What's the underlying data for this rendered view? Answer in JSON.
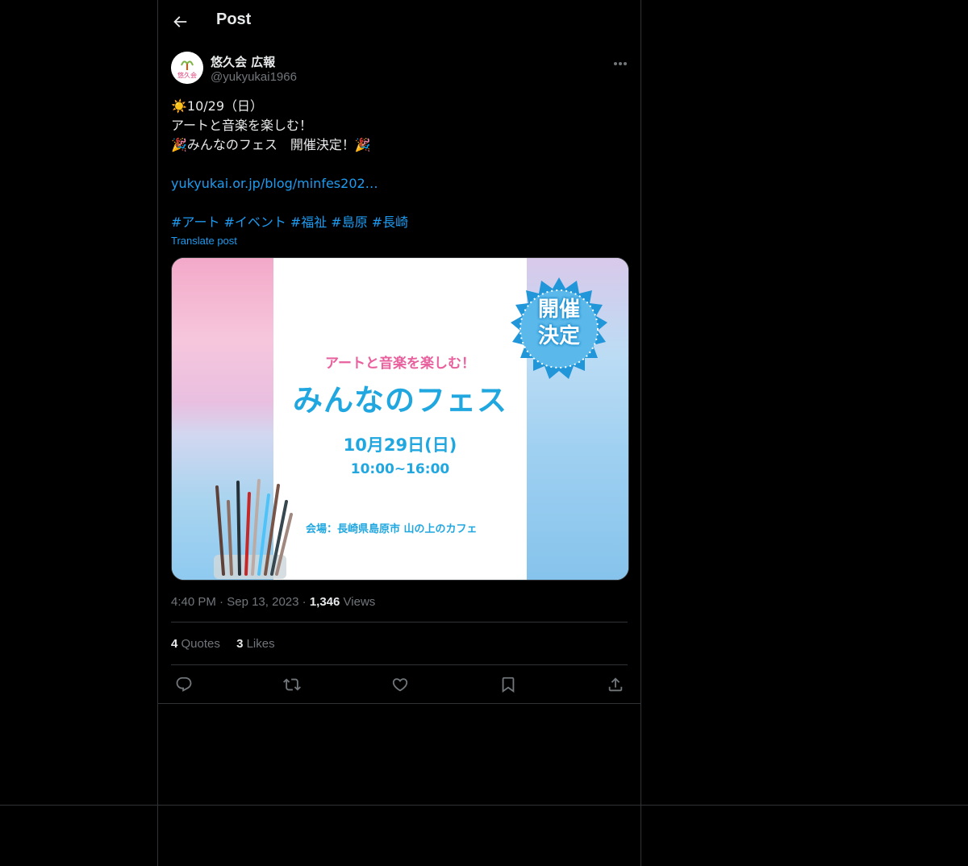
{
  "header": {
    "title": "Post"
  },
  "post": {
    "author_name": "悠久会 広報",
    "handle": "@yukyukai1966",
    "avatar_text": "悠久会",
    "lines": {
      "l1": "☀️10/29（日）",
      "l2": "アートと音楽を楽しむ！",
      "l3": "🎉みんなのフェス　開催決定！🎉"
    },
    "link": "yukyukai.or.jp/blog/minfes202…",
    "hashtags": [
      "#アート",
      "#イベント",
      "#福祉",
      "#島原",
      "#長崎"
    ],
    "translate_label": "Translate post",
    "media": {
      "subtitle": "アートと音楽を楽しむ！",
      "title": "みんなのフェス",
      "date": "10月29日(日)",
      "time": "10:00~16:00",
      "venue": "会場：長崎県島原市 山の上のカフェ",
      "badge_line1": "開催",
      "badge_line2": "決定"
    },
    "time": "4:40 PM",
    "date": "Sep 13, 2023",
    "views_count": "1,346",
    "views_label": "Views",
    "quotes_count": "4",
    "quotes_label": "Quotes",
    "likes_count": "3",
    "likes_label": "Likes"
  },
  "colors": {
    "accent": "#1d9bf0",
    "text": "#e7e9ea",
    "muted": "#71767b",
    "border": "#2f3336"
  },
  "icons": [
    "back-arrow-icon",
    "more-icon",
    "reply-icon",
    "repost-icon",
    "like-icon",
    "bookmark-icon",
    "share-icon"
  ]
}
